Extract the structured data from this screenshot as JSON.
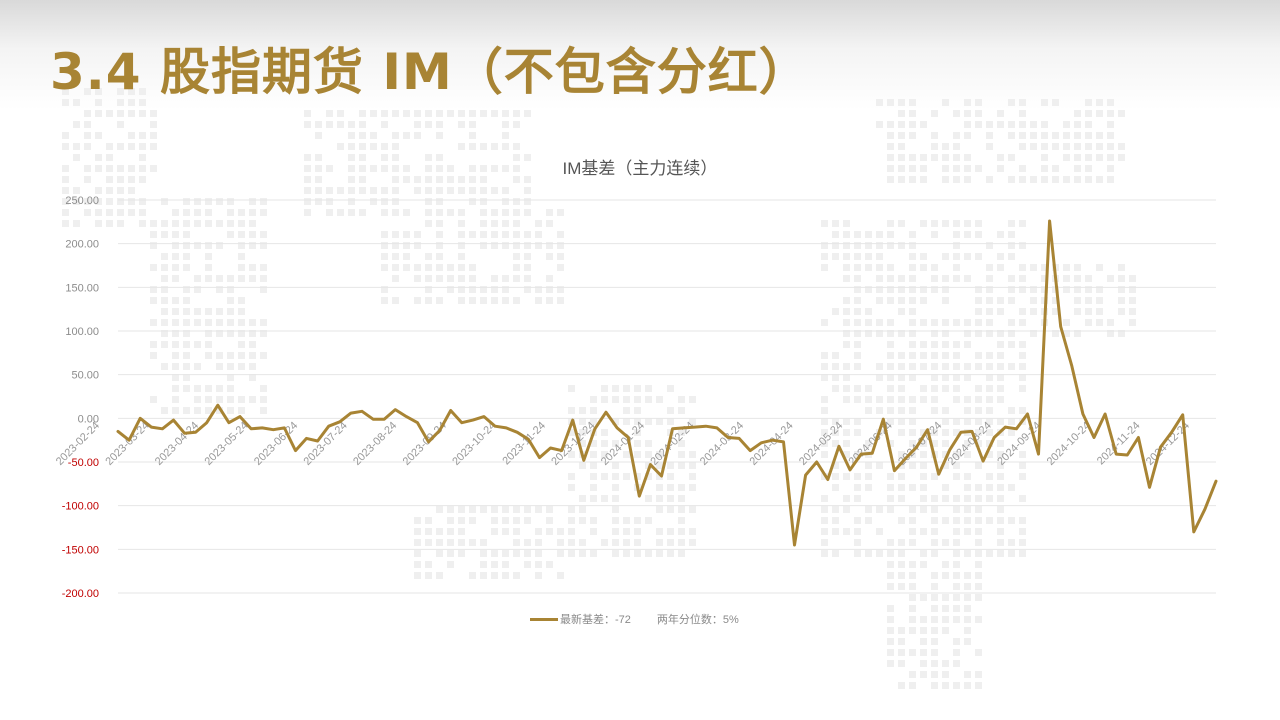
{
  "slide": {
    "title": "3.4 股指期货 IM（不包含分红）",
    "accent_color": "#a88434"
  },
  "chart_data": {
    "type": "line",
    "title": "IM基差（主力连续）",
    "xlabel": "",
    "ylabel": "",
    "ylim": [
      -200,
      250
    ],
    "yticks": [
      250,
      200,
      150,
      100,
      50,
      0,
      -50,
      -100,
      -150,
      -200
    ],
    "ytick_labels": [
      "250.00",
      "200.00",
      "150.00",
      "100.00",
      "50.00",
      "0.00",
      "-50.00",
      "-100.00",
      "-150.00",
      "-200.00"
    ],
    "negative_tick_color": "#c00000",
    "grid": true,
    "xtick_labels": [
      "2023-02-24",
      "2023-03-24",
      "2023-04-24",
      "2023-05-24",
      "2023-06-24",
      "2023-07-24",
      "2023-08-24",
      "2023-09-24",
      "2023-10-24",
      "2023-11-24",
      "2023-12-24",
      "2024-01-24",
      "2024-02-24",
      "2024-03-24",
      "2024-04-24",
      "2024-05-24",
      "2024-06-24",
      "2024-07-24",
      "2024-08-24",
      "2024-09-24",
      "2024-10-24",
      "2024-11-24",
      "2024-12-24"
    ],
    "series": [
      {
        "name": "最新基差：-72",
        "color": "#a88434",
        "values": [
          -15,
          -25,
          0,
          -10,
          -12,
          -2,
          -17,
          -16,
          -5,
          15,
          -5,
          2,
          -12,
          -11,
          -13,
          -11,
          -37,
          -23,
          -26,
          -9,
          -4,
          6,
          8,
          -1,
          -1,
          10,
          2,
          -5,
          -27,
          -14,
          9,
          -5,
          -2,
          2,
          -9,
          -11,
          -16,
          -24,
          -45,
          -34,
          -37,
          -2,
          -48,
          -12,
          7,
          -11,
          -22,
          -89,
          -53,
          -66,
          -12,
          -11,
          -10,
          -9,
          -11,
          -22,
          -23,
          -37,
          -28,
          -25,
          -27,
          -145,
          -65,
          -50,
          -70,
          -32,
          -59,
          -41,
          -40,
          -1,
          -60,
          -46,
          -33,
          -13,
          -64,
          -36,
          -16,
          -15,
          -49,
          -22,
          -10,
          -12,
          5,
          -41,
          226,
          105,
          60,
          5,
          -22,
          5,
          -41,
          -42,
          -22,
          -79,
          -33,
          -16,
          4,
          -130,
          -104,
          -72
        ]
      }
    ],
    "annotation": "两年分位数：5%"
  }
}
